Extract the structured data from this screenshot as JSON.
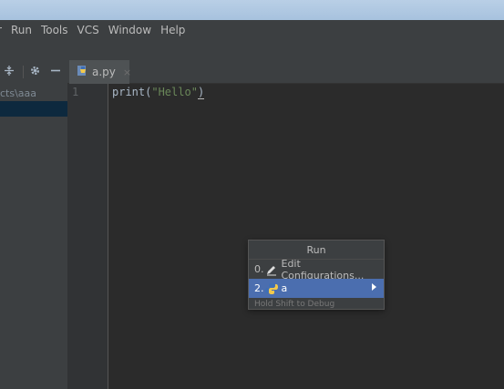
{
  "menubar": {
    "items": [
      "r",
      "Run",
      "Tools",
      "VCS",
      "Window",
      "Help"
    ]
  },
  "project": {
    "path_fragment": "cts\\aaa"
  },
  "tab": {
    "label": "a.py",
    "close": "×"
  },
  "gutter": {
    "line_number": "1"
  },
  "code": {
    "fn": "print",
    "open": "(",
    "string": "\"Hello\"",
    "close": ")"
  },
  "run_popup": {
    "title": "Run",
    "items": [
      {
        "num": "0.",
        "label": "Edit Configurations..."
      },
      {
        "num": "2.",
        "label": "a"
      }
    ],
    "hint": "Hold Shift to Debug"
  },
  "colors": {
    "selection": "#4b6eaf",
    "string": "#6a8759",
    "background": "#2b2b2b"
  }
}
